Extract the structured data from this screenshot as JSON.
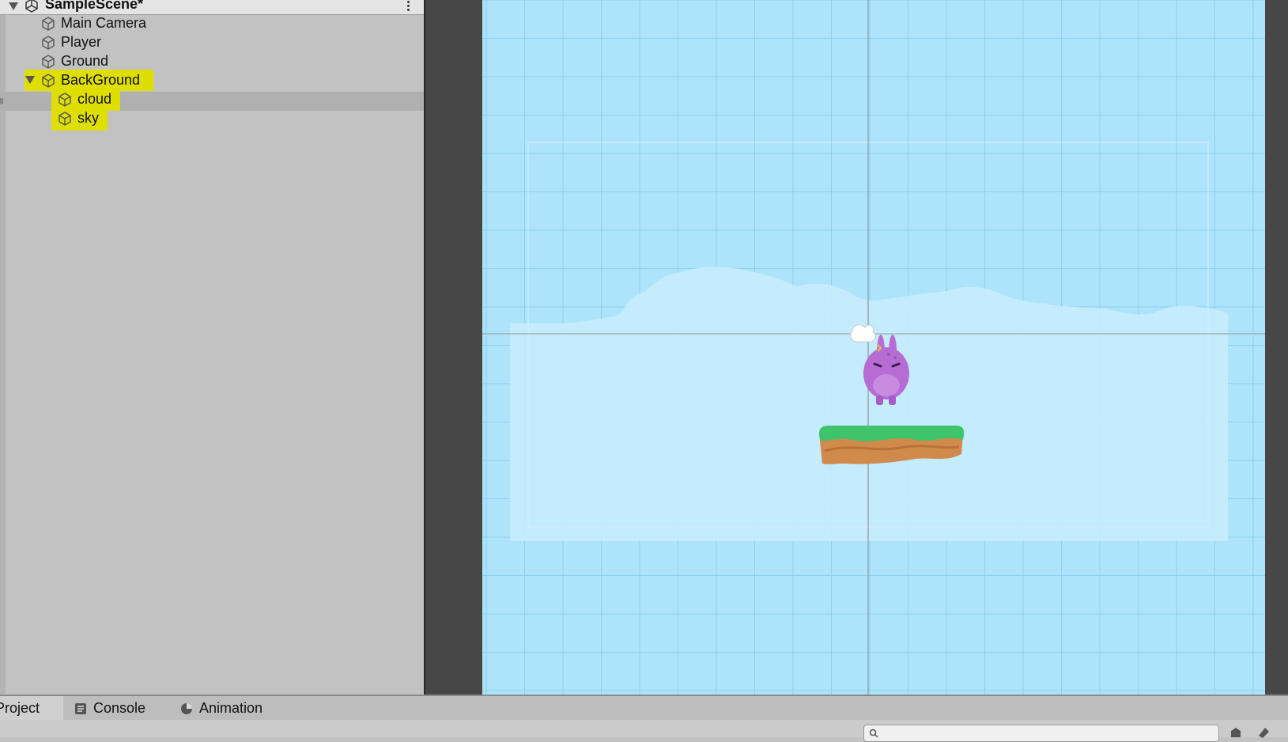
{
  "hierarchy": {
    "scene_title": "SampleScene*",
    "items": [
      {
        "label": "Main Camera",
        "depth": 1
      },
      {
        "label": "Player",
        "depth": 1
      },
      {
        "label": "Ground",
        "depth": 1
      },
      {
        "label": "BackGround",
        "depth": 1,
        "expanded": true,
        "highlighted": true
      },
      {
        "label": "cloud",
        "depth": 2,
        "highlighted": true,
        "selected": true
      },
      {
        "label": "sky",
        "depth": 2,
        "highlighted": true
      }
    ],
    "highlight_color": "#dede00",
    "icons": {
      "scene": "unity-scene-icon",
      "object": "gameobject-cube-icon",
      "menu": "kebab-menu-icon"
    }
  },
  "scene_view": {
    "sky_color": "#aee4fb",
    "grid_line_color": "#8fd0ec",
    "cloud_color": "#c7ecfc",
    "objects": [
      "player-bunny",
      "ground-platform",
      "cloud-background"
    ]
  },
  "bottom": {
    "tabs": [
      {
        "label": "Project",
        "active": true
      },
      {
        "label": "Console",
        "icon": "console-icon"
      },
      {
        "label": "Animation",
        "icon": "animation-icon"
      }
    ],
    "search": {
      "value": "",
      "placeholder": ""
    }
  }
}
